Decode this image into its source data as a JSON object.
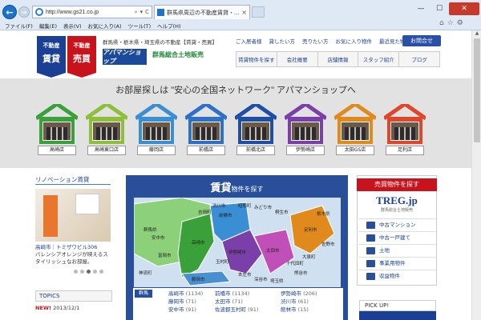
{
  "browser": {
    "url": "http://www.gs21.co.jp",
    "tab_title": "群馬県周辺の不動産賃貸・...",
    "tab_close": "×",
    "back": "←",
    "forward": "→",
    "minimize": "—",
    "maximize": "☐",
    "close": "✕",
    "addr_controls": [
      "⌕",
      "▾",
      "C"
    ],
    "toolbar_icons": [
      "⌂",
      "☆",
      "⚙"
    ],
    "menu": [
      "ファイル(F)",
      "編集(E)",
      "表示(V)",
      "お気に入り(A)",
      "ツール(T)",
      "ヘルプ(H)"
    ]
  },
  "header": {
    "logo_rent": {
      "small": "不動産",
      "big": "賃貸"
    },
    "logo_sale": {
      "small": "不動産",
      "big": "売買"
    },
    "tagline": "群馬県・栃木県・埼玉県の不動産【賃貸・売買】",
    "apaman": "アパマンショップ",
    "gunma": "群馬総合土地販売",
    "top_links": [
      "ご入居者様",
      "貸したい方",
      "売りたい方",
      "お気に入り物件",
      "最近見た物件"
    ],
    "contact": "お問合せ",
    "nav": [
      "賃貸物件を探す",
      "会社概要",
      "店舗情報",
      "スタッフ紹介",
      "ブログ"
    ]
  },
  "band": {
    "headline": "お部屋探しは \"安心の全国ネットワーク\" アパマンショップへ",
    "stores": [
      {
        "name": "高崎店",
        "color": "#3aa13a"
      },
      {
        "name": "高崎東口店",
        "color": "#8dbf3a"
      },
      {
        "name": "藤岡店",
        "color": "#3a8fd4"
      },
      {
        "name": "前橋店",
        "color": "#2e6fc7"
      },
      {
        "name": "前橋北店",
        "color": "#1e4ea8"
      },
      {
        "name": "伊勢崎店",
        "color": "#7a3fa8"
      },
      {
        "name": "太田GS店",
        "color": "#e08a1e"
      },
      {
        "name": "足利店",
        "color": "#e0462a"
      }
    ]
  },
  "renovation": {
    "title": "リノベーション賃貸",
    "caption_title": "高崎市｜トミザワビル306",
    "caption_body": "バレンシアオレンジが映えるスタイリッシュなお部屋。",
    "topics": "TOPICS",
    "news_badge": "NEW!",
    "news_date": "2013/12/1"
  },
  "chintai": {
    "title_big": "賃貸",
    "title_small": "物件を探す",
    "map_labels": [
      "群馬県",
      "栃木県",
      "埼玉県",
      "高崎市",
      "前橋市",
      "伊勢崎市",
      "太田市",
      "足利市",
      "渋川市",
      "桐生市",
      "みどり市",
      "藤岡市",
      "安中市",
      "富岡市",
      "玉村町",
      "吉岡町",
      "本庄市",
      "神流町",
      "熊谷市",
      "深谷市",
      "千代田町",
      "大泉町",
      "佐野市",
      "昭和町"
    ],
    "area_badge": "群馬",
    "areas": [
      {
        "name": "高崎市",
        "count": "(1134)"
      },
      {
        "name": "藤岡市",
        "count": "(71)"
      },
      {
        "name": "安中市",
        "count": "(91)"
      },
      {
        "name": "前橋市",
        "count": "(1134)"
      },
      {
        "name": "太田市",
        "count": "(71)"
      },
      {
        "name": "佐波郡玉村町",
        "count": "(91)"
      },
      {
        "name": "伊勢崎市",
        "count": "(206)"
      },
      {
        "name": "渋川市",
        "count": "(61)"
      },
      {
        "name": "館林市",
        "count": "(15)"
      }
    ]
  },
  "buy": {
    "title": "売買物件を探す",
    "treg": "TREG.jp",
    "treg_sub": "群馬総合土地販売",
    "items": [
      "中古マンション",
      "中古一戸建て",
      "土地",
      "事業用物件",
      "収益物件"
    ],
    "pickup": "PICK UP!"
  }
}
